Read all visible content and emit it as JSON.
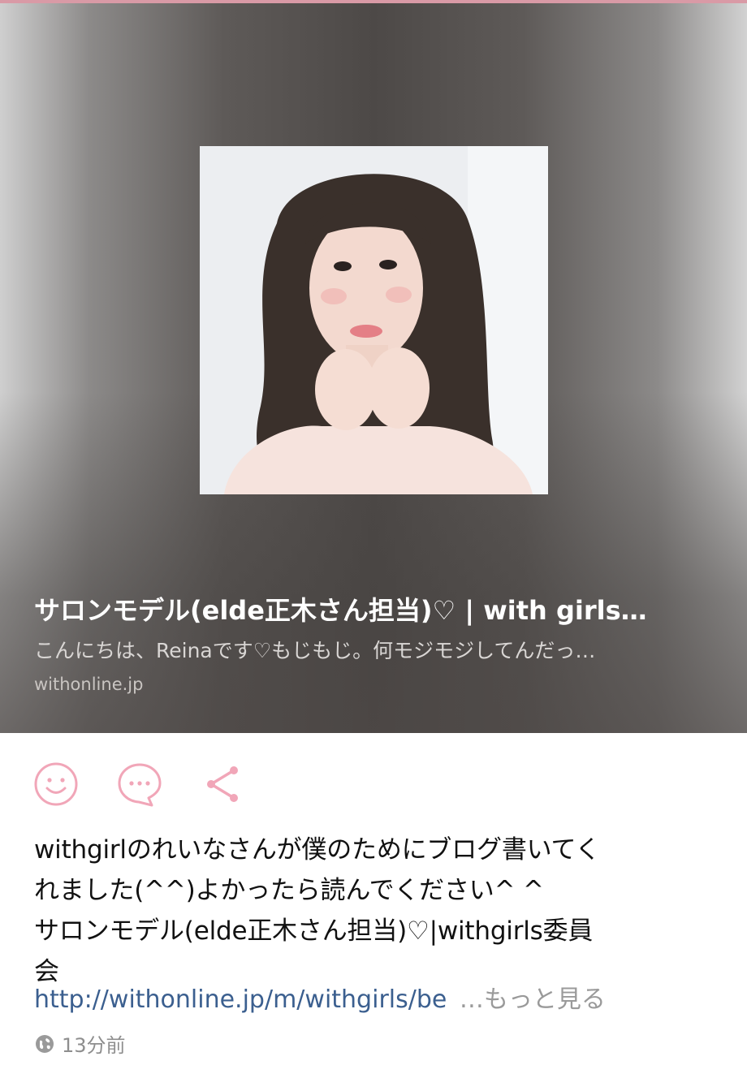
{
  "preview": {
    "title": "サロンモデル(elde正木さん担当)♡ | with girls…",
    "description": "こんにちは、Reinaです♡もじもじ。何モジモジしてんだっ…",
    "domain": "withonline.jp"
  },
  "actions": {
    "icons": [
      "smiley-icon",
      "comment-icon",
      "share-icon"
    ],
    "accent_color": "#f1a6b8"
  },
  "post": {
    "lines": [
      "withgirlのれいなさんが僕のためにブログ書いてく",
      "れました(^^)よかったら読んでください^ ^",
      "サロンモデル(elde正木さん担当)♡|withgirls委員",
      "会"
    ],
    "link_text": "http://withonline.jp/m/withgirls/be",
    "more_label": "…もっと見る"
  },
  "meta": {
    "time": "13分前"
  }
}
